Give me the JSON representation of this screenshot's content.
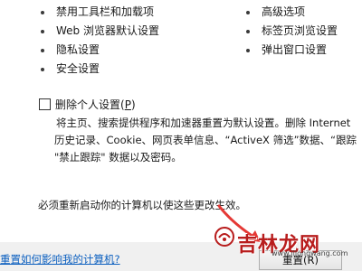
{
  "reset_list": {
    "left_items": [
      "禁用工具栏和加载项",
      "Web 浏览器默认设置",
      "隐私设置",
      "安全设置"
    ],
    "right_items": [
      "高级选项",
      "标签页浏览设置",
      "弹出窗口设置"
    ]
  },
  "delete_personal": {
    "label": "删除个人设置(",
    "accelerator": "P",
    "label_end": ")",
    "checked": false,
    "description_lines": [
      "将主页、搜索提供程序和加速器重置为默认设置。删除 Internet",
      "历史记录、Cookie、网页表单信息、“ActiveX 筛选”数据、“跟踪",
      "\"禁止跟踪\" 数据以及密码。"
    ]
  },
  "restart_note": "必须重新启动你的计算机以使这些更改生效。",
  "footer": {
    "help_link": "重置如何影响我的计算机?",
    "reset_button": "重置(R)"
  },
  "watermark": {
    "text": "吉林龙网",
    "url": "www.jllongwang.com"
  },
  "colors": {
    "link": "#0b5fbf",
    "arrow": "#e53935",
    "watermark": "#b81d1d"
  }
}
